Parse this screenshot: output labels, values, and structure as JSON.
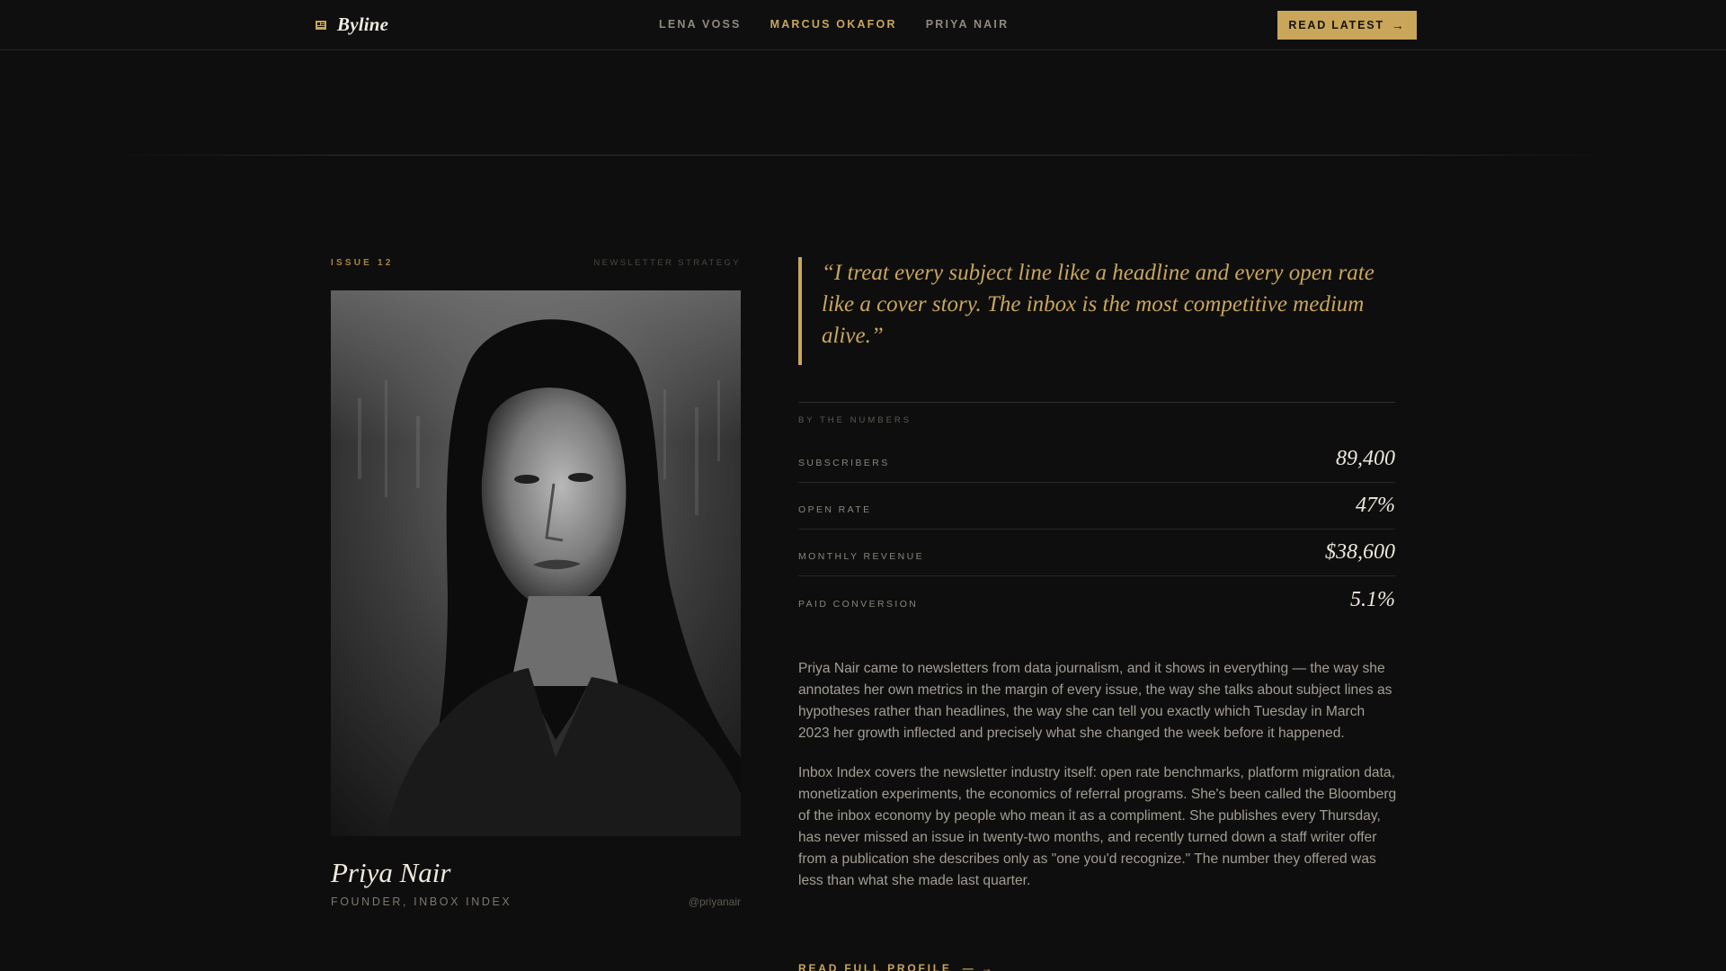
{
  "header": {
    "brand": "Byline",
    "brand_icon": "newspaper-icon",
    "nav": [
      {
        "label": "LENA VOSS",
        "active": false
      },
      {
        "label": "MARCUS OKAFOR",
        "active": true
      },
      {
        "label": "PRIYA NAIR",
        "active": false
      }
    ],
    "cta_label": "READ LATEST",
    "cta_icon": "arrow-right-icon"
  },
  "profile": {
    "issue": "ISSUE 12",
    "category": "NEWSLETTER STRATEGY",
    "name": "Priya Nair",
    "role": "FOUNDER, INBOX INDEX",
    "handle": "@priyanair",
    "portrait_description_icon": "portrait-photo"
  },
  "quote": "“I treat every subject line like a headline and every open rate like a cover story. The inbox is the most competitive medium alive.”",
  "numbers": {
    "label": "BY THE NUMBERS",
    "items": [
      {
        "label": "SUBSCRIBERS",
        "value": "89,400"
      },
      {
        "label": "OPEN RATE",
        "value": "47%"
      },
      {
        "label": "MONTHLY REVENUE",
        "value": "$38,600"
      },
      {
        "label": "PAID CONVERSION",
        "value": "5.1%"
      }
    ]
  },
  "bio": [
    "Priya Nair came to newsletters from data journalism, and it shows in everything — the way she annotates her own metrics in the margin of every issue, the way she talks about subject lines as hypotheses rather than headlines, the way she can tell you exactly which Tuesday in March 2023 her growth inflected and precisely what she changed the week before it happened.",
    "Inbox Index covers the newsletter industry itself: open rate benchmarks, platform migration data, monetization experiments, the economics of referral programs. She's been called the Bloomberg of the inbox economy by people who mean it as a compliment. She publishes every Thursday, has never missed an issue in twenty-two months, and recently turned down a staff writer offer from a publication she describes only as \"one you'd recognize.\" The number they offered was less than what she made last quarter."
  ],
  "read_more": "READ FULL PROFILE",
  "colors": {
    "background": "#0e0e0e",
    "accent": "#c9a65a",
    "text": "#efe9dd",
    "muted": "#8a857a"
  }
}
